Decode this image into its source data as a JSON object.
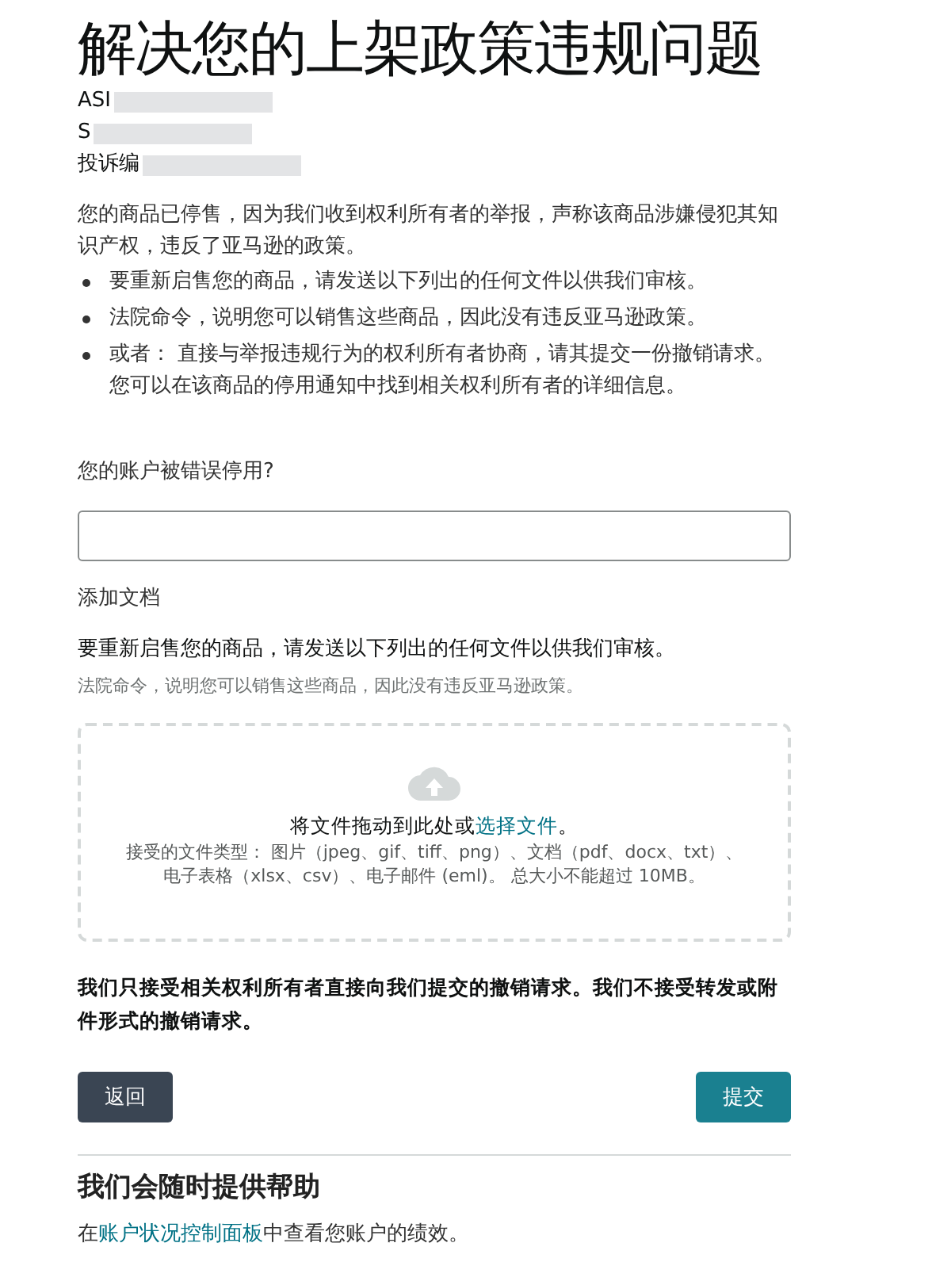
{
  "title": "解决您的上架政策违规问题",
  "identifiers": [
    {
      "label": "ASI"
    },
    {
      "label": "S"
    },
    {
      "label": "投诉编"
    }
  ],
  "intro": "您的商品已停售，因为我们收到权利所有者的举报，声称该商品涉嫌侵犯其知识产权，违反了亚马逊的政策。",
  "bullets": [
    "要重新启售您的商品，请发送以下列出的任何文件以供我们审核。",
    "法院命令，说明您可以销售这些商品，因此没有违反亚马逊政策。",
    "或者：  直接与举报违规行为的权利所有者协商，请其提交一份撤销请求。您可以在该商品的停用通知中找到相关权利所有者的详细信息。"
  ],
  "question": {
    "label": "您的账户被错误停用?"
  },
  "documents": {
    "label": "添加文档",
    "instruction": "要重新启售您的商品，请发送以下列出的任何文件以供我们审核。",
    "hint": "法院命令，说明您可以销售这些商品，因此没有违反亚马逊政策。"
  },
  "upload": {
    "before": "将文件拖动到此处或",
    "link": "选择文件",
    "after": "。",
    "types": "接受的文件类型： 图片（jpeg、gif、tiff、png）、文档（pdf、docx、txt）、电子表格（xlsx、csv）、电子邮件 (eml)。 总大小不能超过 10MB。"
  },
  "notice": "我们只接受相关权利所有者直接向我们提交的撤销请求。我们不接受转发或附件形式的撤销请求。",
  "buttons": {
    "back": "返回",
    "submit": "提交"
  },
  "help": {
    "title": "我们会随时提供帮助",
    "before": "在",
    "link": "账户状况控制面板",
    "after": "中查看您账户的绩效。"
  }
}
